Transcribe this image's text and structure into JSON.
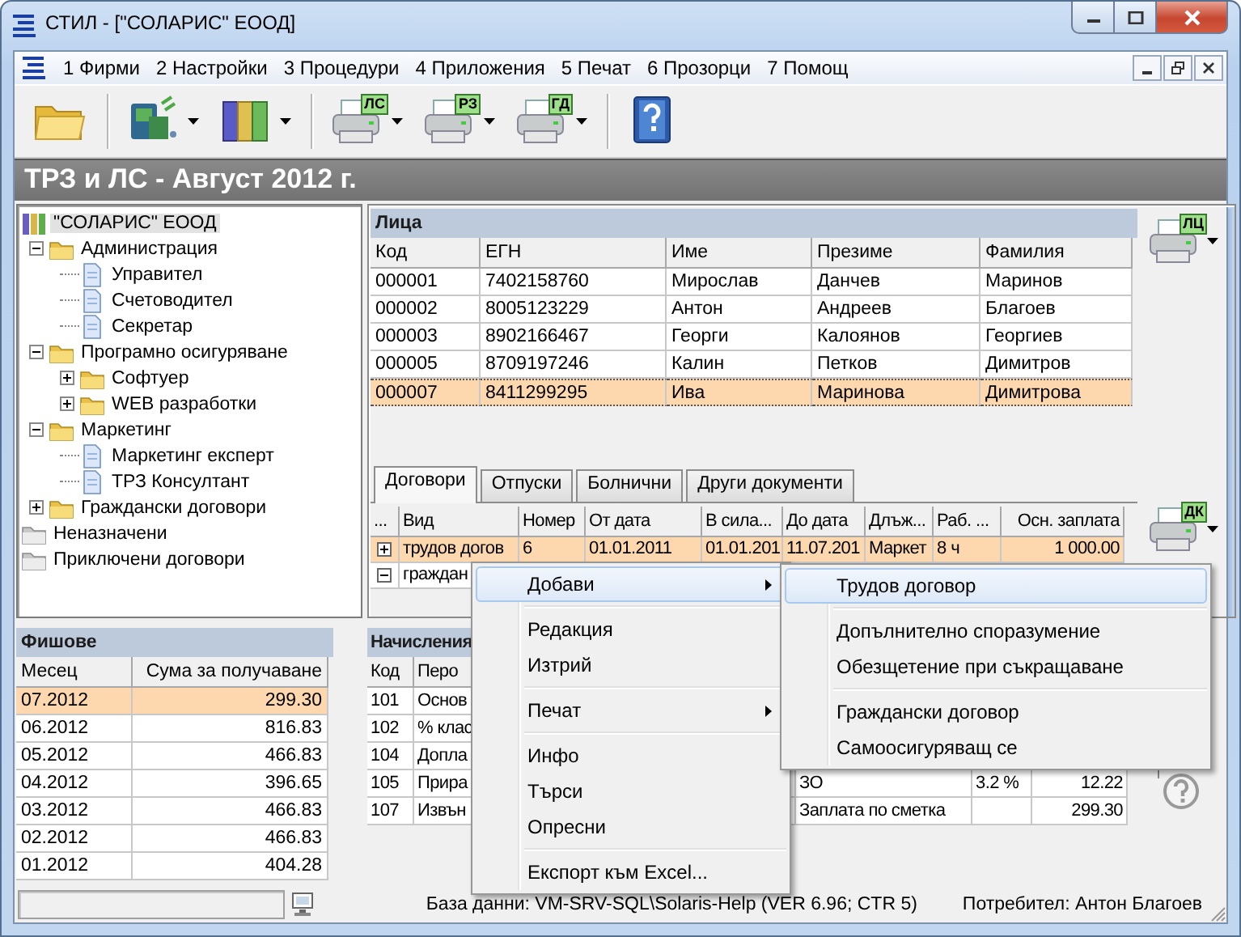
{
  "window": {
    "title": "СТИЛ - [\"СОЛАРИС\" ЕООД]"
  },
  "menu": [
    "1 Фирми",
    "2 Настройки",
    "3 Процедури",
    "4 Приложения",
    "5 Печат",
    "6 Прозорци",
    "7 Помощ"
  ],
  "toolbar": [
    {
      "kind": "folder",
      "dropdown": false
    },
    {
      "kind": "separator"
    },
    {
      "kind": "network",
      "dropdown": true
    },
    {
      "kind": "books",
      "dropdown": true
    },
    {
      "kind": "separator"
    },
    {
      "kind": "printer",
      "badge": "ЛС",
      "dropdown": true
    },
    {
      "kind": "printer",
      "badge": "РЗ",
      "dropdown": true
    },
    {
      "kind": "printer",
      "badge": "ГД",
      "dropdown": true
    },
    {
      "kind": "separator"
    },
    {
      "kind": "help",
      "dropdown": false
    }
  ],
  "header": "ТРЗ и ЛС - Август 2012 г.",
  "tree": [
    {
      "label": "\"СОЛАРИС\" ЕООД",
      "kind": "company",
      "selected": true,
      "children": [
        {
          "label": "Администрация",
          "kind": "folder",
          "selected": false,
          "expanded": true,
          "children": [
            {
              "label": "Управител",
              "kind": "document",
              "selected": false
            },
            {
              "label": "Счетоводител",
              "kind": "document",
              "selected": false
            },
            {
              "label": "Секретар",
              "kind": "document",
              "selected": false
            }
          ]
        },
        {
          "label": "Програмно осигуряване",
          "kind": "folder",
          "selected": false,
          "expanded": true,
          "children": [
            {
              "label": "Софтуер",
              "kind": "folder",
              "selected": false,
              "expanded": false
            },
            {
              "label": "WEB разработки",
              "kind": "folder",
              "selected": false,
              "expanded": false
            }
          ]
        },
        {
          "label": "Маркетинг",
          "kind": "folder",
          "selected": false,
          "expanded": true,
          "children": [
            {
              "label": "Маркетинг експерт",
              "kind": "document",
              "selected": false
            },
            {
              "label": "ТРЗ Консултант",
              "kind": "document",
              "selected": false
            }
          ]
        },
        {
          "label": "Граждански договори",
          "kind": "folder",
          "selected": false,
          "expanded": false
        }
      ]
    },
    {
      "label": "Неназначени",
      "kind": "archive",
      "selected": false
    },
    {
      "label": "Приключени договори",
      "kind": "archive",
      "selected": false
    }
  ],
  "persons": {
    "title": "Лица",
    "badge": "ЛЦ",
    "columns": [
      "Код",
      "ЕГН",
      "Име",
      "Презиме",
      "Фамилия"
    ],
    "rows": [
      {
        "cells": [
          "000001",
          "7402158760",
          "Мирослав",
          "Данчев",
          "Маринов"
        ],
        "selected": false
      },
      {
        "cells": [
          "000002",
          "8005123229",
          "Антон",
          "Андреев",
          "Благоев"
        ],
        "selected": false
      },
      {
        "cells": [
          "000003",
          "8902166467",
          "Георги",
          "Калоянов",
          "Георгиев"
        ],
        "selected": false
      },
      {
        "cells": [
          "000005",
          "8709197246",
          "Калин",
          "Петков",
          "Димитров"
        ],
        "selected": false
      },
      {
        "cells": [
          "000007",
          "8411299295",
          "Ива",
          "Маринова",
          "Димитрова"
        ],
        "selected": true
      }
    ]
  },
  "tabs": [
    {
      "label": "Договори",
      "selected": true
    },
    {
      "label": "Отпуски",
      "selected": false
    },
    {
      "label": "Болнични",
      "selected": false
    },
    {
      "label": "Други документи",
      "selected": false
    }
  ],
  "contracts": {
    "badge": "ДК",
    "toggle_header": "...",
    "columns": [
      "Вид",
      "Номер",
      "От дата",
      "В сила...",
      "До дата",
      "Длъж...",
      "Раб. ...",
      "Осн. заплата"
    ],
    "rows": [
      {
        "expanded": false,
        "selected": true,
        "cells": [
          "трудов догов",
          "6",
          "01.01.2011",
          "01.01.201",
          "11.07.201",
          "Маркет",
          "8 ч",
          "1 000.00"
        ]
      },
      {
        "expanded": true,
        "selected": false,
        "cells": [
          "граждан"
        ]
      }
    ]
  },
  "payslips": {
    "title": "Фишове",
    "columns": [
      "Месец",
      "Сума за получаване"
    ],
    "rows": [
      {
        "cells": [
          "07.2012",
          "299.30"
        ],
        "selected": true
      },
      {
        "cells": [
          "06.2012",
          "816.83"
        ],
        "selected": false
      },
      {
        "cells": [
          "05.2012",
          "466.83"
        ],
        "selected": false
      },
      {
        "cells": [
          "04.2012",
          "396.65"
        ],
        "selected": false
      },
      {
        "cells": [
          "03.2012",
          "466.83"
        ],
        "selected": false
      },
      {
        "cells": [
          "02.2012",
          "466.83"
        ],
        "selected": false
      },
      {
        "cells": [
          "01.2012",
          "404.28"
        ],
        "selected": false
      }
    ]
  },
  "earnings": {
    "title": "Начисления",
    "columns": [
      "Код",
      "Перо"
    ],
    "rows": [
      {
        "cells": [
          "101",
          "Основ"
        ]
      },
      {
        "cells": [
          "102",
          "% клас"
        ]
      },
      {
        "cells": [
          "104",
          "Допла"
        ]
      },
      {
        "cells": [
          "105",
          "Прира"
        ],
        "column_1": "ЗО",
        "column_2": "3.2 %",
        "column_3": "12.22"
      },
      {
        "cells": [
          "107",
          "Извън"
        ],
        "column_1": "Заплата по сметка",
        "column_3": "299.30"
      }
    ]
  },
  "context_menu": {
    "items": [
      {
        "kind": "item",
        "label": "Добави",
        "submenu": true,
        "selected": true
      },
      {
        "kind": "separator"
      },
      {
        "kind": "item",
        "label": "Редакция",
        "submenu": false,
        "selected": false
      },
      {
        "kind": "item",
        "label": "Изтрий",
        "submenu": false,
        "selected": false
      },
      {
        "kind": "separator"
      },
      {
        "kind": "item",
        "label": "Печат",
        "submenu": true,
        "selected": false
      },
      {
        "kind": "separator"
      },
      {
        "kind": "item",
        "label": "Инфо",
        "submenu": false,
        "selected": false
      },
      {
        "kind": "item",
        "label": "Търси",
        "submenu": false,
        "selected": false
      },
      {
        "kind": "item",
        "label": "Опресни",
        "submenu": false,
        "selected": false
      },
      {
        "kind": "separator"
      },
      {
        "kind": "item",
        "label": "Експорт към Excel...",
        "submenu": false,
        "selected": false
      }
    ]
  },
  "submenu": {
    "items": [
      {
        "kind": "item",
        "label": "Трудов договор",
        "submenu": false,
        "selected": true
      },
      {
        "kind": "separator"
      },
      {
        "kind": "item",
        "label": "Допълнително споразумение",
        "submenu": false,
        "selected": false
      },
      {
        "kind": "item",
        "label": "Обезщетение при съкращаване",
        "submenu": false,
        "selected": false
      },
      {
        "kind": "separator"
      },
      {
        "kind": "item",
        "label": "Граждански договор",
        "submenu": false,
        "selected": false
      },
      {
        "kind": "item",
        "label": "Самоосигуряващ се",
        "submenu": false,
        "selected": false
      }
    ]
  },
  "status_bar": {
    "database": "База данни: VM-SRV-SQL\\Solaris-Help (VER 6.96; CTR 5)",
    "user": "Потребител: Антон Благоев"
  }
}
